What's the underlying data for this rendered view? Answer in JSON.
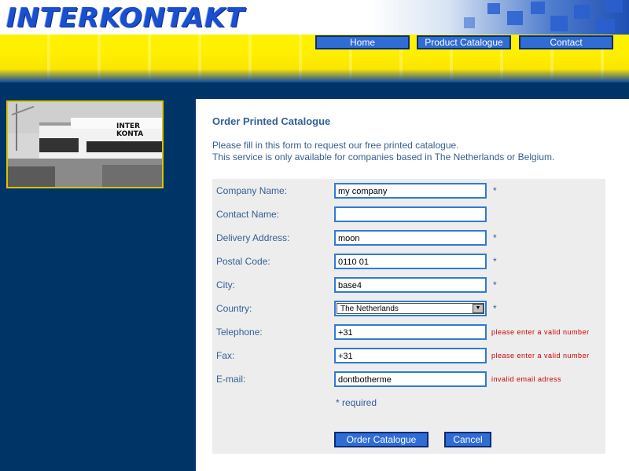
{
  "brand": {
    "logo": "INTERKONTAKT"
  },
  "nav": {
    "home": "Home",
    "catalogue": "Product Catalogue",
    "contact": "Contact"
  },
  "photo": {
    "sign": "INTER KONTA"
  },
  "page": {
    "title": "Order Printed Catalogue",
    "intro_line1": "Please fill in this form to request our free printed catalogue.",
    "intro_line2": "This service is only available for companies based in The Netherlands or Belgium."
  },
  "form": {
    "company_label": "Company Name:",
    "company_value": "my company",
    "contact_label": "Contact Name:",
    "contact_value": "",
    "address_label": "Delivery Address:",
    "address_value": "moon",
    "postal_label": "Postal Code:",
    "postal_value": "0110 01",
    "city_label": "City:",
    "city_value": "base4",
    "country_label": "Country:",
    "country_value": "The Netherlands",
    "telephone_label": "Telephone:",
    "telephone_value": "+31",
    "telephone_error": "please enter a valid number",
    "fax_label": "Fax:",
    "fax_value": "+31",
    "fax_error": "please enter a valid number",
    "email_label": "E-mail:",
    "email_value": "dontbotherme",
    "email_error": "invalid email adress",
    "required_marker": "*",
    "required_note": "* required",
    "submit_label": "Order Catalogue",
    "cancel_label": "Cancel"
  },
  "colors": {
    "accent_blue": "#2f6cd4",
    "header_yellow": "#fff200",
    "background_navy": "#003366",
    "label_text": "#335f94",
    "error_red": "#cc0000"
  },
  "icons": {
    "select_arrow": "chevron-down-icon"
  }
}
